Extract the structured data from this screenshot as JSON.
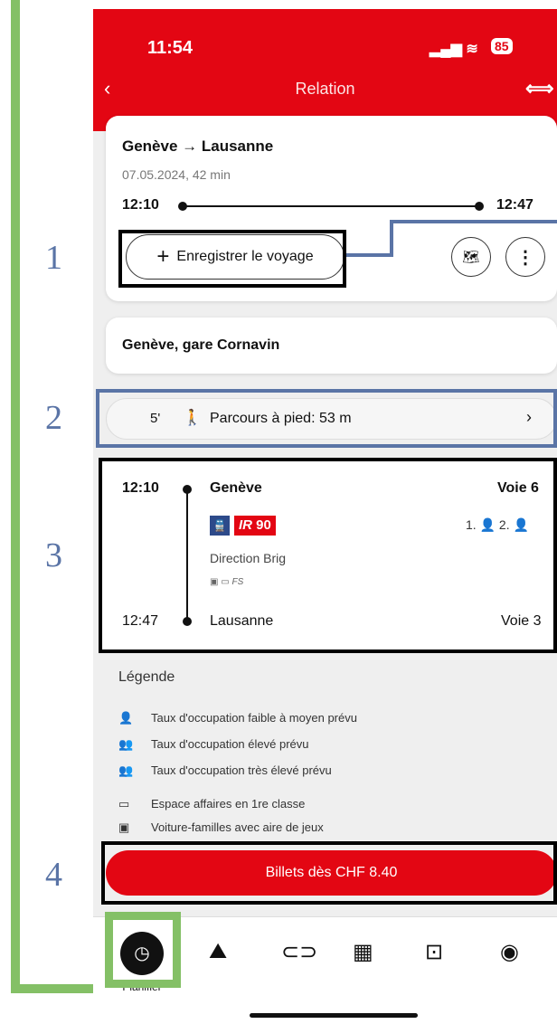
{
  "status_bar": {
    "time": "11:54",
    "battery": "85",
    "signal": "▂▄▆ ≋"
  },
  "nav": {
    "back_icon": "‹",
    "title": "Relation",
    "logo": "⟺"
  },
  "trip": {
    "route": "Genève → Lausanne",
    "date_duration": "07.05.2024, 42 min",
    "departure": "12:10",
    "arrival": "12:47",
    "save_button": "Enregistrer le voyage"
  },
  "station": {
    "name": "Genève, gare Cornavin"
  },
  "walk": {
    "minutes": "5'",
    "label": "Parcours à pied: 53 m"
  },
  "journey": {
    "dep_time": "12:10",
    "dep_station": "Genève",
    "dep_platform": "Voie 6",
    "train_number": "90",
    "train_type": "IR",
    "direction": "Direction Brig",
    "amenities": "FS",
    "class_1": "1.",
    "class_2": "2.",
    "arr_time": "12:47",
    "arr_station": "Lausanne",
    "arr_platform": "Voie 3"
  },
  "legend": {
    "title": "Légende",
    "items": [
      "Taux d'occupation faible à moyen prévu",
      "Taux d'occupation élevé prévu",
      "Taux d'occupation très élevé prévu",
      "Espace affaires en 1re classe",
      "Voiture-familles avec aire de jeux"
    ]
  },
  "tickets_button": "Billets dès CHF 8.40",
  "tabbar": {
    "active_label": "Planifier"
  },
  "annotations": [
    "1",
    "2",
    "3",
    "4"
  ],
  "colors": {
    "brand": "#e30613",
    "annotation_green": "#84c066",
    "annotation_blue": "#5a74a6"
  }
}
